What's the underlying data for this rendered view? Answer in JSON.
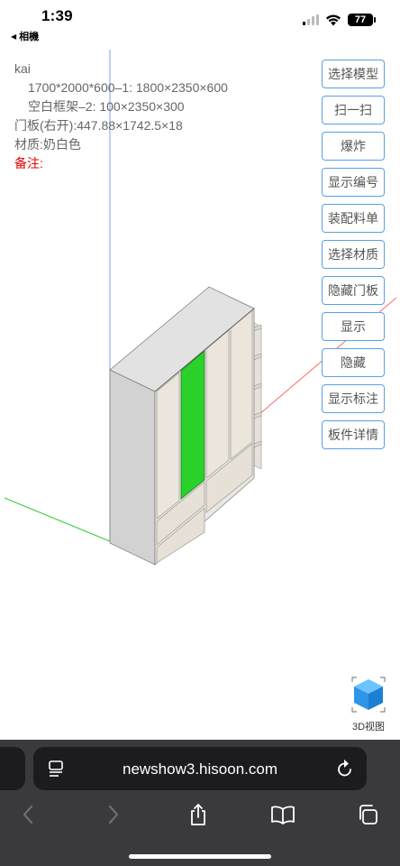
{
  "status_bar": {
    "time": "1:39",
    "back_app": "相機",
    "battery": "77"
  },
  "info": {
    "name": "kai",
    "line1": "1700*2000*600–1: 1800×2350×600",
    "line2": "空白框架–2: 100×2350×300",
    "line3": "门板(右开):447.88×1742.5×18",
    "line4": "材质:奶白色",
    "remark": "备注:"
  },
  "buttons": [
    {
      "label": "选择模型"
    },
    {
      "label": "扫一扫"
    },
    {
      "label": "爆炸"
    },
    {
      "label": "显示编号"
    },
    {
      "label": "装配料单"
    },
    {
      "label": "选择材质"
    },
    {
      "label": "隐藏门板"
    },
    {
      "label": "显示"
    },
    {
      "label": "隐藏"
    },
    {
      "label": "显示标注"
    },
    {
      "label": "板件详情"
    }
  ],
  "view3d": {
    "label": "3D视图",
    "icon": "cube-icon"
  },
  "browser": {
    "url": "newshow3.hisoon.com",
    "toolbar_icons": [
      "back-arrow-icon",
      "forward-arrow-icon",
      "share-icon",
      "bookmarks-icon",
      "tabs-icon"
    ]
  },
  "colors": {
    "accent": "#5aa0e6",
    "selected_panel": "#2bd12b",
    "remark": "#e00000",
    "cabinet_side": "#d2d2d2",
    "door": "#e8e3dc"
  }
}
